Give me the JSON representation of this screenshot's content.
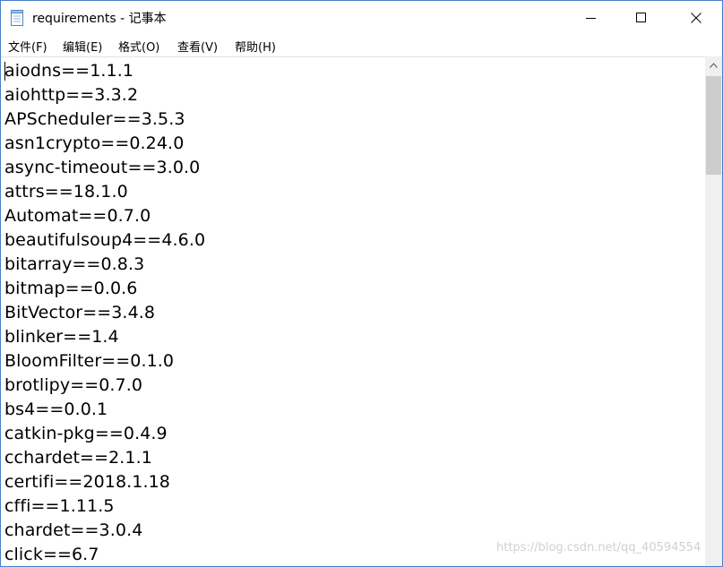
{
  "window": {
    "title": "requirements - 记事本"
  },
  "menu": [
    "文件(F)",
    "编辑(E)",
    "格式(O)",
    "查看(V)",
    "帮助(H)"
  ],
  "lines": [
    "aiodns==1.1.1",
    "aiohttp==3.3.2",
    "APScheduler==3.5.3",
    "asn1crypto==0.24.0",
    "async-timeout==3.0.0",
    "attrs==18.1.0",
    "Automat==0.7.0",
    "beautifulsoup4==4.6.0",
    "bitarray==0.8.3",
    "bitmap==0.0.6",
    "BitVector==3.4.8",
    "blinker==1.4",
    "BloomFilter==0.1.0",
    "brotlipy==0.7.0",
    "bs4==0.0.1",
    "catkin-pkg==0.4.9",
    "cchardet==2.1.1",
    "certifi==2018.1.18",
    "cffi==1.11.5",
    "chardet==3.0.4",
    "click==6.7"
  ],
  "watermark": "https://blog.csdn.net/qq_40594554",
  "icons": {
    "app": "notepad-icon",
    "minimize": "minimize-icon",
    "maximize": "maximize-icon",
    "close": "close-icon",
    "scroll_up": "scroll-up-arrow-icon"
  }
}
